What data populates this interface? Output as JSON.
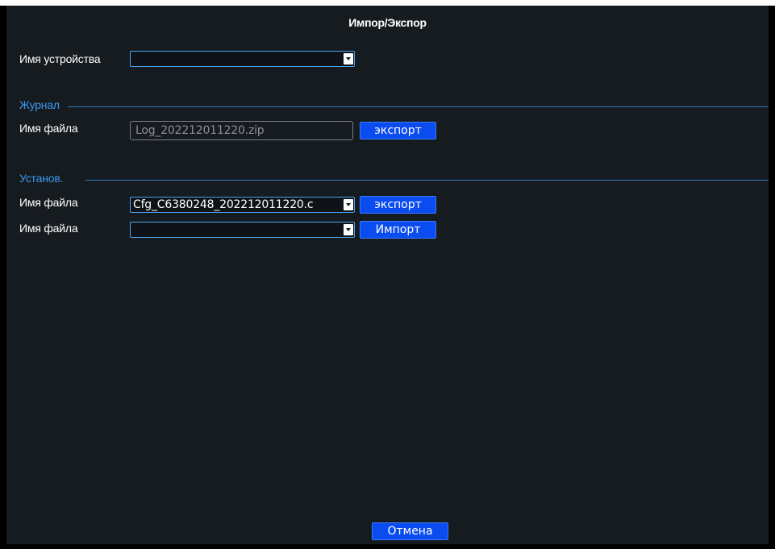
{
  "window": {
    "title": "Импор/Экспор"
  },
  "device": {
    "label": "Имя устройства",
    "value": ""
  },
  "journal": {
    "title": "Журнал",
    "file_label": "Имя файла",
    "file_value": "Log_202212011220.zip",
    "export_label": "экспорт"
  },
  "settings": {
    "title": "Установ.",
    "export_row": {
      "label": "Имя файла",
      "value": "Cfg_C6380248_202212011220.c",
      "button": "экспорт"
    },
    "import_row": {
      "label": "Имя файла",
      "value": "",
      "button": "Импорт"
    }
  },
  "footer": {
    "cancel_label": "Отмена"
  },
  "icons": {
    "dropdown": "chevron-down-icon"
  },
  "colors": {
    "panel_bg": "#161b20",
    "accent": "#3a9af0",
    "button": "#0a4cf0"
  }
}
